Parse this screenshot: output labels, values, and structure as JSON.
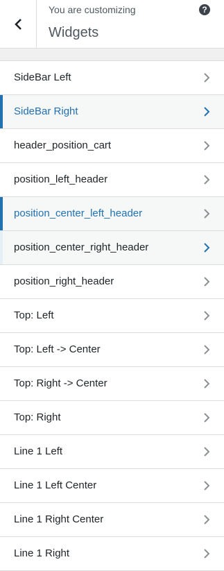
{
  "header": {
    "subtitle": "You are customizing",
    "title": "Widgets",
    "help_glyph": "?",
    "back_icon": "chevron-left-icon",
    "help_icon": "help-icon"
  },
  "colors": {
    "accent": "#2271b1",
    "text": "#1d2327",
    "muted": "#50575e",
    "border": "#dcdcde",
    "chevron_default": "#8c8f94"
  },
  "sections": [
    {
      "label": "SideBar Left"
    },
    {
      "label": "SideBar Right"
    },
    {
      "label": "header_position_cart"
    },
    {
      "label": "position_left_header"
    },
    {
      "label": "position_center_left_header"
    },
    {
      "label": "position_center_right_header"
    },
    {
      "label": "position_right_header"
    },
    {
      "label": "Top: Left"
    },
    {
      "label": "Top: Left -> Center"
    },
    {
      "label": "Top: Right -> Center"
    },
    {
      "label": "Top: Right"
    },
    {
      "label": "Line 1 Left"
    },
    {
      "label": "Line 1 Left Center"
    },
    {
      "label": "Line 1 Right Center"
    },
    {
      "label": "Line 1 Right"
    }
  ]
}
